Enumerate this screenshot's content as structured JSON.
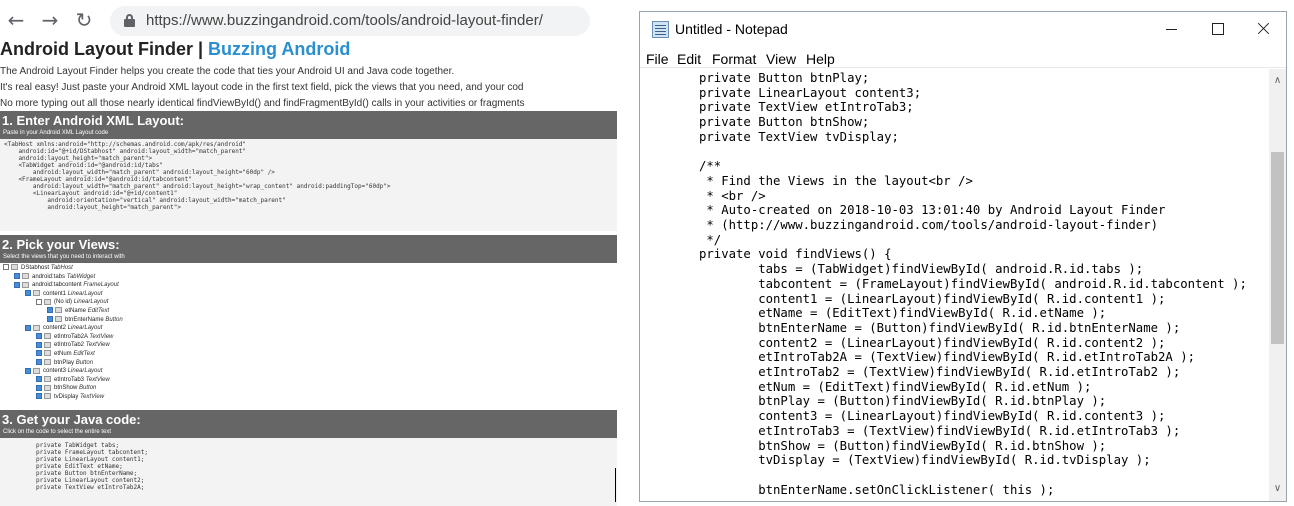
{
  "browser": {
    "nav": {
      "back": "←",
      "forward": "→",
      "reload": "↻"
    },
    "url": "https://www.buzzingandroid.com/tools/android-layout-finder/",
    "page": {
      "title": "Android Layout Finder | ",
      "title_accent": "Buzzing Android",
      "intro": [
        "The Android Layout Finder helps you create the code that ties your Android UI and Java code together.",
        "It's real easy! Just paste your Android XML layout code in the first text field, pick the views that you need, and your cod",
        "No more typing out all those nearly identical findViewById() and findFragmentById() calls in your activities or fragments"
      ],
      "section1": {
        "title": "1. Enter Android XML Layout:",
        "subtitle": "Paste in your Android XML Layout code",
        "xml_lines": [
          "<TabHost xmlns:android=\"http://schemas.android.com/apk/res/android\"",
          "    android:id=\"@+id/DStabhost\" android:layout_width=\"match_parent\"",
          "    android:layout_height=\"match_parent\">",
          "    <TabWidget android:id=\"@android:id/tabs\"",
          "        android:layout_width=\"match_parent\" android:layout_height=\"60dp\" />",
          "    <FrameLayout android:id=\"@android:id/tabcontent\"",
          "        android:layout_width=\"match_parent\" android:layout_height=\"wrap_content\" android:paddingTop=\"60dp\">",
          "        <LinearLayout android:id=\"@+id/content1\"",
          "            android:orientation=\"vertical\" android:layout_width=\"match_parent\"",
          "            android:layout_height=\"match_parent\">"
        ]
      },
      "section2": {
        "title": "2. Pick your Views:",
        "subtitle": "Select the views that you need to interact with",
        "tree": [
          {
            "name": "DStabhost",
            "type": "TabHost",
            "level": 0,
            "checked": false
          },
          {
            "name": "android:tabs",
            "type": "TabWidget",
            "level": 1,
            "checked": true
          },
          {
            "name": "android:tabcontent",
            "type": "FrameLayout",
            "level": 1,
            "checked": true
          },
          {
            "name": "content1",
            "type": "LinearLayout",
            "level": 2,
            "checked": true
          },
          {
            "name": "(No id)",
            "type": "LinearLayout",
            "level": 3,
            "checked": false
          },
          {
            "name": "etName",
            "type": "EditText",
            "level": 4,
            "checked": true
          },
          {
            "name": "btnEnterName",
            "type": "Button",
            "level": 4,
            "checked": true
          },
          {
            "name": "content2",
            "type": "LinearLayout",
            "level": 2,
            "checked": true
          },
          {
            "name": "etIntroTab2A",
            "type": "TextView",
            "level": 3,
            "checked": true
          },
          {
            "name": "etIntroTab2",
            "type": "TextView",
            "level": 3,
            "checked": true
          },
          {
            "name": "etNum",
            "type": "EditText",
            "level": 3,
            "checked": true
          },
          {
            "name": "btnPlay",
            "type": "Button",
            "level": 3,
            "checked": true
          },
          {
            "name": "content3",
            "type": "LinearLayout",
            "level": 2,
            "checked": true
          },
          {
            "name": "etIntroTab3",
            "type": "TextView",
            "level": 3,
            "checked": true
          },
          {
            "name": "btnShow",
            "type": "Button",
            "level": 3,
            "checked": true
          },
          {
            "name": "tvDisplay",
            "type": "TextView",
            "level": 3,
            "checked": true
          }
        ]
      },
      "section3": {
        "title": "3. Get your Java code:",
        "subtitle": "Click on the code to select the entire text",
        "java_lines": [
          "private TabWidget tabs;",
          "private FrameLayout tabcontent;",
          "private LinearLayout content1;",
          "private EditText etName;",
          "private Button btnEnterName;",
          "private LinearLayout content2;",
          "private TextView etIntroTab2A;"
        ]
      }
    }
  },
  "notepad": {
    "title": "Untitled - Notepad",
    "menu": [
      "File",
      "Edit",
      "Format",
      "View",
      "Help"
    ],
    "code_lines": [
      "private Button btnPlay;",
      "private LinearLayout content3;",
      "private TextView etIntroTab3;",
      "private Button btnShow;",
      "private TextView tvDisplay;",
      "",
      "/**",
      " * Find the Views in the layout<br />",
      " * <br />",
      " * Auto-created on 2018-10-03 13:01:40 by Android Layout Finder",
      " * (http://www.buzzingandroid.com/tools/android-layout-finder)",
      " */",
      "private void findViews() {",
      "        tabs = (TabWidget)findViewById( android.R.id.tabs );",
      "        tabcontent = (FrameLayout)findViewById( android.R.id.tabcontent );",
      "        content1 = (LinearLayout)findViewById( R.id.content1 );",
      "        etName = (EditText)findViewById( R.id.etName );",
      "        btnEnterName = (Button)findViewById( R.id.btnEnterName );",
      "        content2 = (LinearLayout)findViewById( R.id.content2 );",
      "        etIntroTab2A = (TextView)findViewById( R.id.etIntroTab2A );",
      "        etIntroTab2 = (TextView)findViewById( R.id.etIntroTab2 );",
      "        etNum = (EditText)findViewById( R.id.etNum );",
      "        btnPlay = (Button)findViewById( R.id.btnPlay );",
      "        content3 = (LinearLayout)findViewById( R.id.content3 );",
      "        etIntroTab3 = (TextView)findViewById( R.id.etIntroTab3 );",
      "        btnShow = (Button)findViewById( R.id.btnShow );",
      "        tvDisplay = (TextView)findViewById( R.id.tvDisplay );",
      "",
      "        btnEnterName.setOnClickListener( this );"
    ],
    "scroll": {
      "up": "∧",
      "down": "∨"
    }
  }
}
